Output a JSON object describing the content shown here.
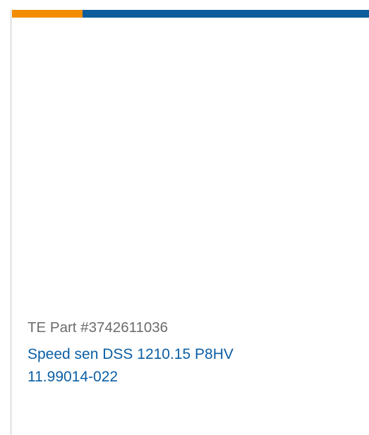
{
  "colors": {
    "accent_orange": "#f28c00",
    "accent_blue": "#0a5d9a",
    "part_number_text": "#6b6b6b",
    "title_link": "#0b5fa5"
  },
  "product": {
    "part_number_label": "TE Part #3742611036",
    "title_line1": "Speed sen DSS 1210.15 P8HV",
    "title_line2": "11.99014-022"
  }
}
